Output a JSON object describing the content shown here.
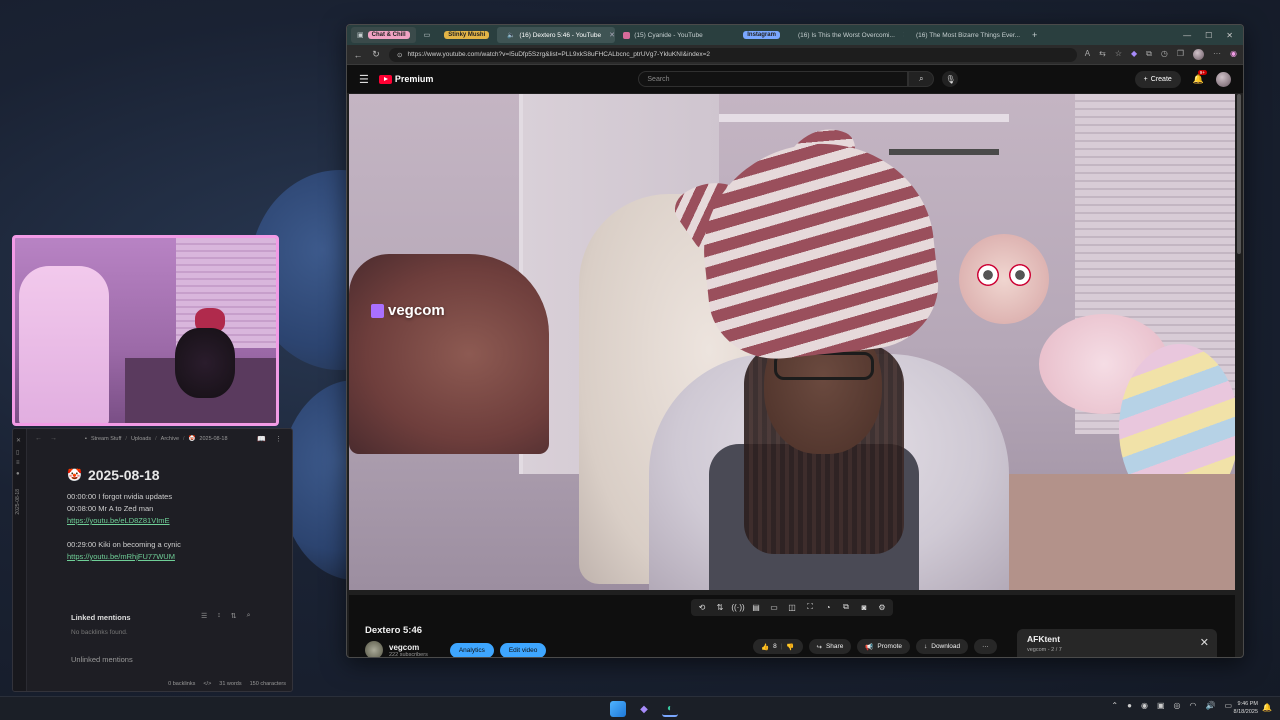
{
  "browser": {
    "tabs": [
      {
        "label": "Chat & Chill",
        "kind": "group-home"
      },
      {
        "label": "",
        "kind": "page-icon"
      },
      {
        "label": "Stinky Mushi",
        "kind": "group"
      },
      {
        "label": "(16) Dextero 5:46 - YouTube",
        "kind": "active"
      },
      {
        "label": "(15) Cyanide - YouTube",
        "kind": "normal"
      },
      {
        "label": "Instagram",
        "kind": "group-tag"
      },
      {
        "label": "(16) Is This the Worst Overcomi...",
        "kind": "normal"
      },
      {
        "label": "(16) The Most Bizarre Things Ever...",
        "kind": "normal"
      }
    ],
    "new_tab": "+",
    "url": "https://www.youtube.com/watch?v=I5uDfp5Szrg&list=PLL9xkS8uFHCALbcnc_ptrUVg7-YkluKNI&index=2"
  },
  "youtube": {
    "logo_text": "Premium",
    "search_placeholder": "Search",
    "create_label": "Create",
    "notif_count": "9+",
    "watermark": "vegcom",
    "video_title": "Dextero 5:46",
    "channel_name": "vegcom",
    "channel_subs": "222 subscribers",
    "analytics_label": "Analytics",
    "edit_label": "Edit video",
    "like_count": "8",
    "share_label": "Share",
    "promote_label": "Promote",
    "download_label": "Download",
    "more_label": "···",
    "next_title": "AFKtent",
    "next_sub": "vegcom - 2 / 7"
  },
  "obsidian": {
    "breadcrumb": [
      "Stream Stuff",
      "Uploads",
      "Archive",
      "2025-08-18"
    ],
    "rail_date": "2025-08-18",
    "note_title": "2025-08-18",
    "lines": [
      {
        "text": "00:00:00 I forgot nvidia updates",
        "link": false
      },
      {
        "text": "00:08:00 Mr A to Zed man",
        "link": false
      },
      {
        "text": "https://youtu.be/eLD8Z81VImE",
        "link": true
      },
      {
        "text": "",
        "link": false
      },
      {
        "text": "00:29:00 Kiki on becoming a cynic",
        "link": false
      },
      {
        "text": "https://youtu.be/mRhjFU77WUM",
        "link": true
      }
    ],
    "linked_mentions": "Linked mentions",
    "no_backlinks": "No backlinks found.",
    "unlinked_mentions": "Unlinked mentions",
    "status_backlinks": "0 backlinks",
    "status_words": "31 words",
    "status_chars": "150 characters"
  },
  "taskbar": {
    "time": "9:46 PM",
    "date": "8/18/2025"
  }
}
